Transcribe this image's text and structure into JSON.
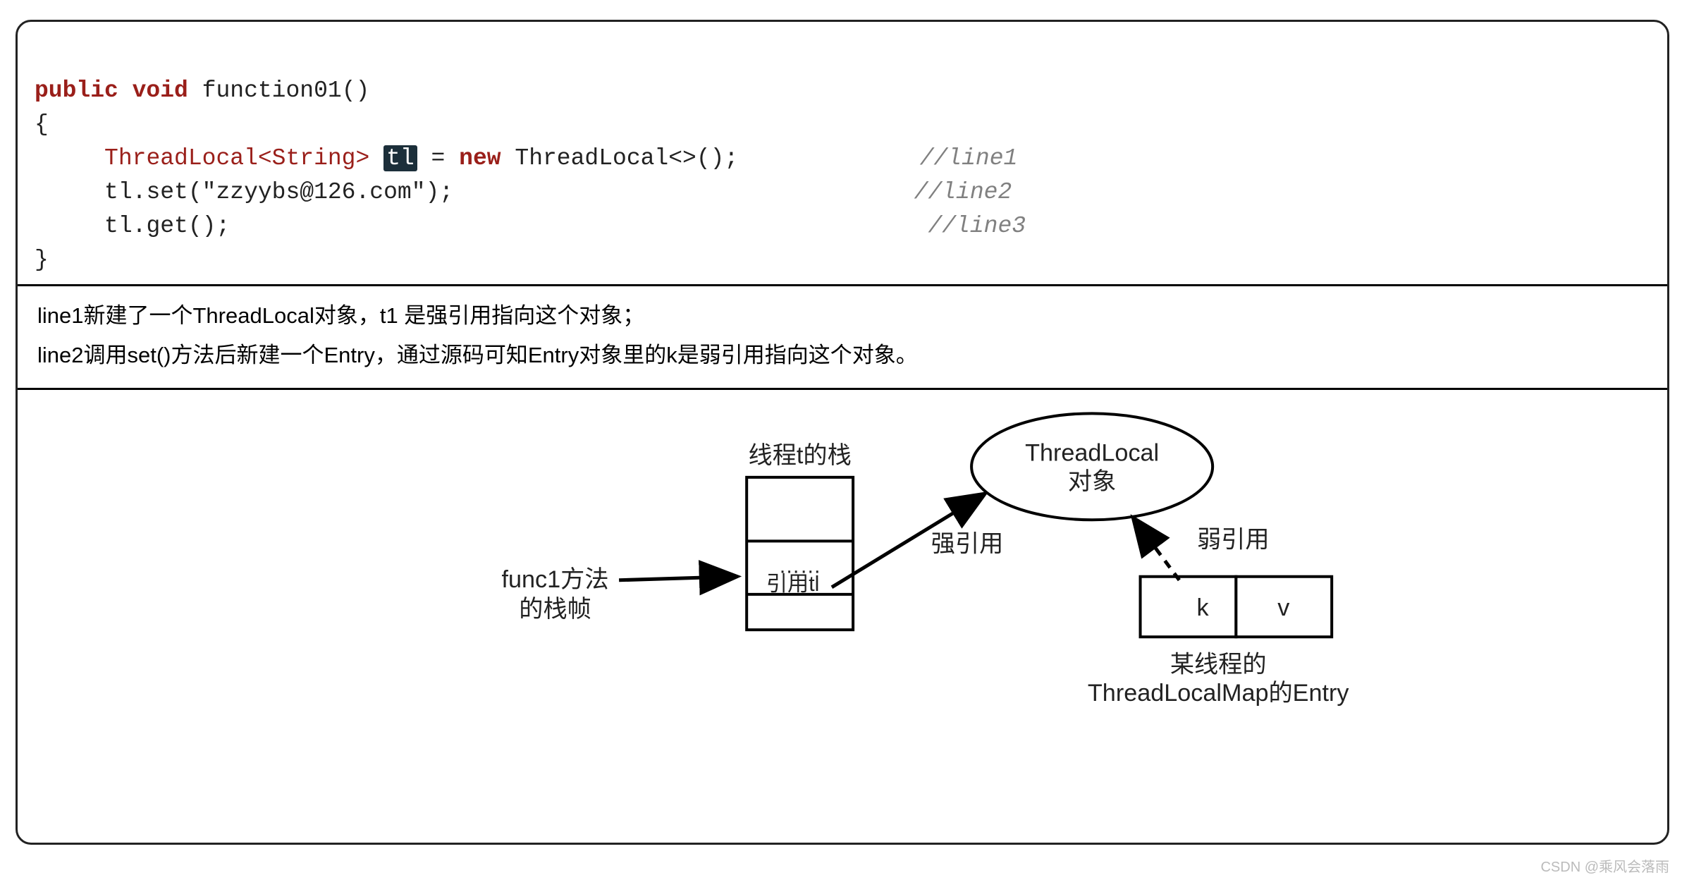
{
  "code": {
    "declaration_kw": "public void",
    "declaration_fn": "function01()",
    "brace_open": "{",
    "line1_type": "ThreadLocal<String>",
    "line1_var": "tl",
    "line1_eq": "=",
    "line1_new_kw": "new",
    "line1_new_rest": "ThreadLocal<>();",
    "line1_comment": "//line1",
    "line2_text": "tl.set(\"zzyybs@126.com\");",
    "line2_comment": "//line2",
    "line3_text": "tl.get();",
    "line3_comment": "//line3",
    "brace_close": "}"
  },
  "explain": {
    "line1": "line1新建了一个ThreadLocal对象，t1 是强引用指向这个对象；",
    "line2": "line2调用set()方法后新建一个Entry，通过源码可知Entry对象里的k是弱引用指向这个对象。"
  },
  "diagram": {
    "func1_label_line1": "func1方法",
    "func1_label_line2": "的栈帧",
    "stack_title": "线程t的栈",
    "stack_mid": "……",
    "stack_bottom": "引用tl",
    "strong_ref": "强引用",
    "weak_ref": "弱引用",
    "ellipse_line1": "ThreadLocal",
    "ellipse_line2": "对象",
    "entry_k": "k",
    "entry_v": "v",
    "entry_title_line1": "某线程的",
    "entry_title_line2": "ThreadLocalMap的Entry"
  },
  "watermark": "CSDN @乘风会落雨"
}
